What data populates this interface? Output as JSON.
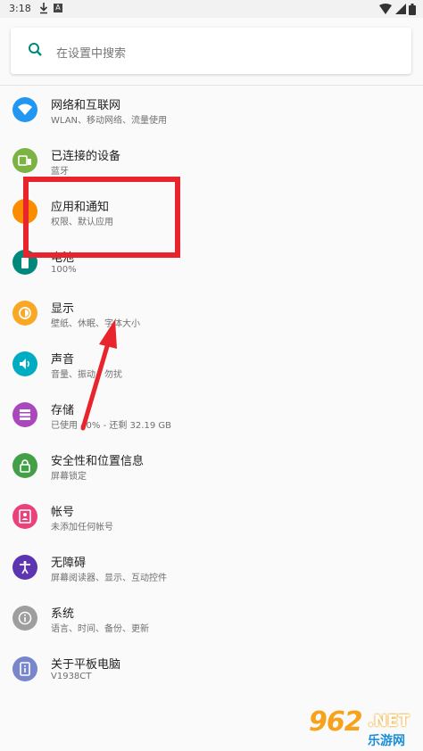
{
  "status": {
    "time": "3:18",
    "notif_letter": "A"
  },
  "search": {
    "placeholder": "在设置中搜索"
  },
  "items": [
    {
      "title": "网络和互联网",
      "subtitle": "WLAN、移动网络、流量使用",
      "icon": "wifi-icon",
      "color": "#2196f3"
    },
    {
      "title": "已连接的设备",
      "subtitle": "蓝牙",
      "icon": "devices-icon",
      "color": "#7cb342"
    },
    {
      "title": "应用和通知",
      "subtitle": "权限、默认应用",
      "icon": "apps-icon",
      "color": "#fb8c00"
    },
    {
      "title": "电池",
      "subtitle": "100%",
      "icon": "battery-icon",
      "color": "#00897b"
    },
    {
      "title": "显示",
      "subtitle": "壁纸、休眠、字体大小",
      "icon": "display-icon",
      "color": "#f9a825"
    },
    {
      "title": "声音",
      "subtitle": "音量、振动、勿扰",
      "icon": "sound-icon",
      "color": "#00acc1"
    },
    {
      "title": "存储",
      "subtitle": "已使用 40% - 还剩 32.19 GB",
      "icon": "storage-icon",
      "color": "#ab47bc"
    },
    {
      "title": "安全性和位置信息",
      "subtitle": "屏幕锁定",
      "icon": "security-icon",
      "color": "#43a047"
    },
    {
      "title": "帐号",
      "subtitle": "未添加任何帐号",
      "icon": "account-icon",
      "color": "#ec407a"
    },
    {
      "title": "无障碍",
      "subtitle": "屏幕阅读器、显示、互动控件",
      "icon": "accessibility-icon",
      "color": "#5e35b1"
    },
    {
      "title": "系统",
      "subtitle": "语言、时间、备份、更新",
      "icon": "info-icon",
      "color": "#9e9e9e"
    },
    {
      "title": "关于平板电脑",
      "subtitle": "V1938CT",
      "icon": "tablet-icon",
      "color": "#7986cb"
    }
  ],
  "watermark": {
    "number": "962",
    "suffix": ".NET",
    "site": "乐游网"
  }
}
